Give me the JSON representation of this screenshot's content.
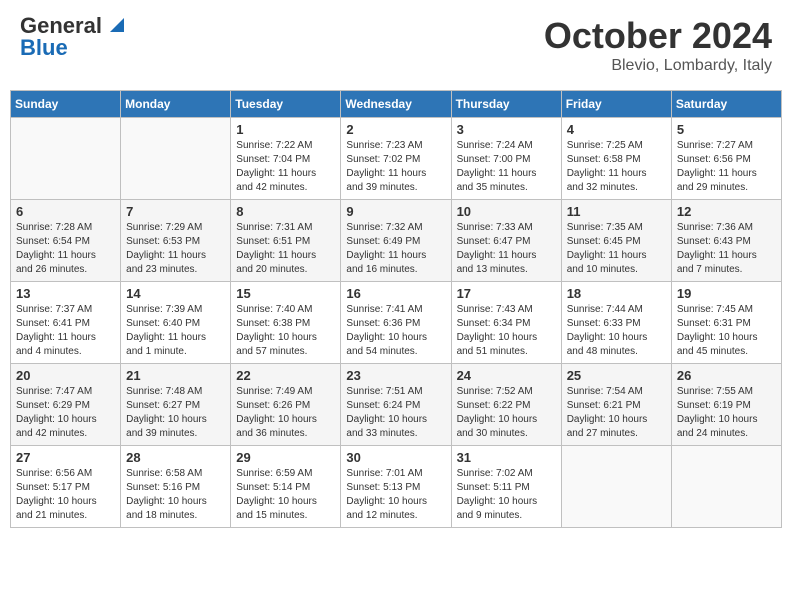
{
  "header": {
    "logo_general": "General",
    "logo_blue": "Blue",
    "month": "October 2024",
    "location": "Blevio, Lombardy, Italy"
  },
  "days_of_week": [
    "Sunday",
    "Monday",
    "Tuesday",
    "Wednesday",
    "Thursday",
    "Friday",
    "Saturday"
  ],
  "weeks": [
    [
      {
        "day": "",
        "empty": true
      },
      {
        "day": "",
        "empty": true
      },
      {
        "day": "1",
        "sunrise": "Sunrise: 7:22 AM",
        "sunset": "Sunset: 7:04 PM",
        "daylight": "Daylight: 11 hours and 42 minutes."
      },
      {
        "day": "2",
        "sunrise": "Sunrise: 7:23 AM",
        "sunset": "Sunset: 7:02 PM",
        "daylight": "Daylight: 11 hours and 39 minutes."
      },
      {
        "day": "3",
        "sunrise": "Sunrise: 7:24 AM",
        "sunset": "Sunset: 7:00 PM",
        "daylight": "Daylight: 11 hours and 35 minutes."
      },
      {
        "day": "4",
        "sunrise": "Sunrise: 7:25 AM",
        "sunset": "Sunset: 6:58 PM",
        "daylight": "Daylight: 11 hours and 32 minutes."
      },
      {
        "day": "5",
        "sunrise": "Sunrise: 7:27 AM",
        "sunset": "Sunset: 6:56 PM",
        "daylight": "Daylight: 11 hours and 29 minutes."
      }
    ],
    [
      {
        "day": "6",
        "sunrise": "Sunrise: 7:28 AM",
        "sunset": "Sunset: 6:54 PM",
        "daylight": "Daylight: 11 hours and 26 minutes."
      },
      {
        "day": "7",
        "sunrise": "Sunrise: 7:29 AM",
        "sunset": "Sunset: 6:53 PM",
        "daylight": "Daylight: 11 hours and 23 minutes."
      },
      {
        "day": "8",
        "sunrise": "Sunrise: 7:31 AM",
        "sunset": "Sunset: 6:51 PM",
        "daylight": "Daylight: 11 hours and 20 minutes."
      },
      {
        "day": "9",
        "sunrise": "Sunrise: 7:32 AM",
        "sunset": "Sunset: 6:49 PM",
        "daylight": "Daylight: 11 hours and 16 minutes."
      },
      {
        "day": "10",
        "sunrise": "Sunrise: 7:33 AM",
        "sunset": "Sunset: 6:47 PM",
        "daylight": "Daylight: 11 hours and 13 minutes."
      },
      {
        "day": "11",
        "sunrise": "Sunrise: 7:35 AM",
        "sunset": "Sunset: 6:45 PM",
        "daylight": "Daylight: 11 hours and 10 minutes."
      },
      {
        "day": "12",
        "sunrise": "Sunrise: 7:36 AM",
        "sunset": "Sunset: 6:43 PM",
        "daylight": "Daylight: 11 hours and 7 minutes."
      }
    ],
    [
      {
        "day": "13",
        "sunrise": "Sunrise: 7:37 AM",
        "sunset": "Sunset: 6:41 PM",
        "daylight": "Daylight: 11 hours and 4 minutes."
      },
      {
        "day": "14",
        "sunrise": "Sunrise: 7:39 AM",
        "sunset": "Sunset: 6:40 PM",
        "daylight": "Daylight: 11 hours and 1 minute."
      },
      {
        "day": "15",
        "sunrise": "Sunrise: 7:40 AM",
        "sunset": "Sunset: 6:38 PM",
        "daylight": "Daylight: 10 hours and 57 minutes."
      },
      {
        "day": "16",
        "sunrise": "Sunrise: 7:41 AM",
        "sunset": "Sunset: 6:36 PM",
        "daylight": "Daylight: 10 hours and 54 minutes."
      },
      {
        "day": "17",
        "sunrise": "Sunrise: 7:43 AM",
        "sunset": "Sunset: 6:34 PM",
        "daylight": "Daylight: 10 hours and 51 minutes."
      },
      {
        "day": "18",
        "sunrise": "Sunrise: 7:44 AM",
        "sunset": "Sunset: 6:33 PM",
        "daylight": "Daylight: 10 hours and 48 minutes."
      },
      {
        "day": "19",
        "sunrise": "Sunrise: 7:45 AM",
        "sunset": "Sunset: 6:31 PM",
        "daylight": "Daylight: 10 hours and 45 minutes."
      }
    ],
    [
      {
        "day": "20",
        "sunrise": "Sunrise: 7:47 AM",
        "sunset": "Sunset: 6:29 PM",
        "daylight": "Daylight: 10 hours and 42 minutes."
      },
      {
        "day": "21",
        "sunrise": "Sunrise: 7:48 AM",
        "sunset": "Sunset: 6:27 PM",
        "daylight": "Daylight: 10 hours and 39 minutes."
      },
      {
        "day": "22",
        "sunrise": "Sunrise: 7:49 AM",
        "sunset": "Sunset: 6:26 PM",
        "daylight": "Daylight: 10 hours and 36 minutes."
      },
      {
        "day": "23",
        "sunrise": "Sunrise: 7:51 AM",
        "sunset": "Sunset: 6:24 PM",
        "daylight": "Daylight: 10 hours and 33 minutes."
      },
      {
        "day": "24",
        "sunrise": "Sunrise: 7:52 AM",
        "sunset": "Sunset: 6:22 PM",
        "daylight": "Daylight: 10 hours and 30 minutes."
      },
      {
        "day": "25",
        "sunrise": "Sunrise: 7:54 AM",
        "sunset": "Sunset: 6:21 PM",
        "daylight": "Daylight: 10 hours and 27 minutes."
      },
      {
        "day": "26",
        "sunrise": "Sunrise: 7:55 AM",
        "sunset": "Sunset: 6:19 PM",
        "daylight": "Daylight: 10 hours and 24 minutes."
      }
    ],
    [
      {
        "day": "27",
        "sunrise": "Sunrise: 6:56 AM",
        "sunset": "Sunset: 5:17 PM",
        "daylight": "Daylight: 10 hours and 21 minutes."
      },
      {
        "day": "28",
        "sunrise": "Sunrise: 6:58 AM",
        "sunset": "Sunset: 5:16 PM",
        "daylight": "Daylight: 10 hours and 18 minutes."
      },
      {
        "day": "29",
        "sunrise": "Sunrise: 6:59 AM",
        "sunset": "Sunset: 5:14 PM",
        "daylight": "Daylight: 10 hours and 15 minutes."
      },
      {
        "day": "30",
        "sunrise": "Sunrise: 7:01 AM",
        "sunset": "Sunset: 5:13 PM",
        "daylight": "Daylight: 10 hours and 12 minutes."
      },
      {
        "day": "31",
        "sunrise": "Sunrise: 7:02 AM",
        "sunset": "Sunset: 5:11 PM",
        "daylight": "Daylight: 10 hours and 9 minutes."
      },
      {
        "day": "",
        "empty": true
      },
      {
        "day": "",
        "empty": true
      }
    ]
  ]
}
